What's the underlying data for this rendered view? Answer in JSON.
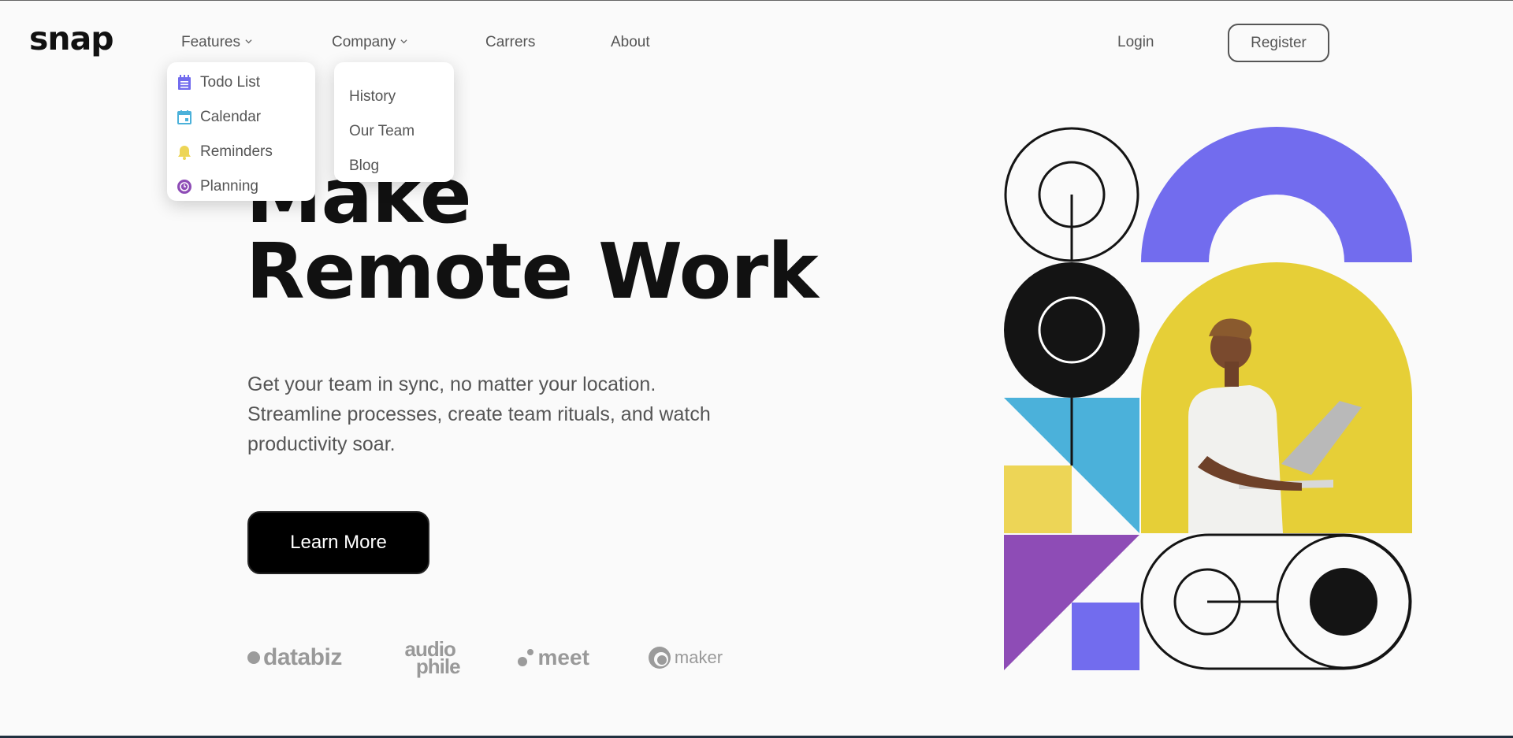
{
  "header": {
    "logo": "snap",
    "nav": {
      "features_label": "Features",
      "company_label": "Company",
      "careers_label": "Carrers",
      "about_label": "About"
    },
    "login_label": "Login",
    "register_label": "Register"
  },
  "features_menu": {
    "items": [
      {
        "label": "Todo List",
        "icon": "todo-icon",
        "color": "#726CEE"
      },
      {
        "label": "Calendar",
        "icon": "calendar-icon",
        "color": "#4BB1DA"
      },
      {
        "label": "Reminders",
        "icon": "bell-icon",
        "color": "#EDD556"
      },
      {
        "label": "Planning",
        "icon": "planning-icon",
        "color": "#8E4CB6"
      }
    ]
  },
  "company_menu": {
    "items": [
      {
        "label": "History"
      },
      {
        "label": "Our Team"
      },
      {
        "label": "Blog"
      }
    ]
  },
  "hero": {
    "title_line1": "Make",
    "title_line2": "Remote Work",
    "description": "Get your team in sync, no matter your location. Streamline processes, create team rituals, and watch productivity soar.",
    "cta_label": "Learn More"
  },
  "clients": {
    "databiz": "databiz",
    "audiophile_top": "audio",
    "audiophile_bottom": "phile",
    "meet": "meet",
    "maker": "maker"
  },
  "colors": {
    "purple": "#726CEE",
    "blue": "#4BB1DA",
    "yellow": "#EDD556",
    "violet": "#8E4CB6",
    "dark": "#141414"
  }
}
